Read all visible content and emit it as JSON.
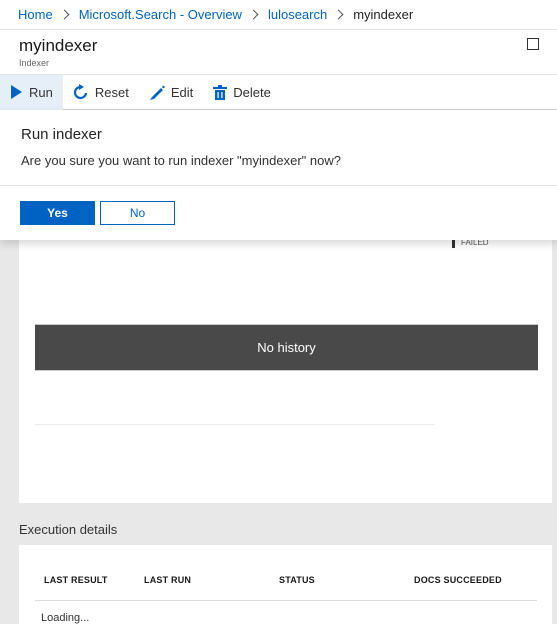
{
  "breadcrumb": {
    "items": [
      "Home",
      "Microsoft.Search - Overview",
      "lulosearch"
    ],
    "current": "myindexer"
  },
  "header": {
    "title": "myindexer",
    "subtitle": "Indexer"
  },
  "toolbar": {
    "run_label": "Run",
    "reset_label": "Reset",
    "edit_label": "Edit",
    "delete_label": "Delete"
  },
  "dialog": {
    "title": "Run indexer",
    "message": "Are you sure you want to run indexer \"myindexer\" now?",
    "yes_label": "Yes",
    "no_label": "No"
  },
  "history": {
    "legend_label": "FAILED",
    "empty_message": "No history"
  },
  "execution": {
    "heading": "Execution details",
    "columns": [
      "LAST RESULT",
      "LAST RUN",
      "STATUS",
      "DOCS SUCCEEDED"
    ],
    "loading": "Loading..."
  },
  "colors": {
    "accent": "#0063c4",
    "toolbar_active_bg": "#e6eef8",
    "no_history_bg": "#494949"
  },
  "icons": [
    "play-icon",
    "reset-icon",
    "edit-icon",
    "delete-icon",
    "maximize-icon",
    "chevron-right-icon"
  ]
}
